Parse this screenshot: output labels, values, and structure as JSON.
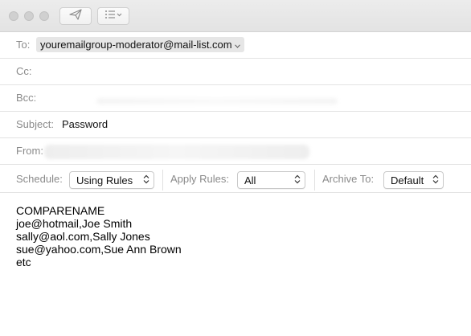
{
  "toolbar": {
    "send_icon": "paper-plane-icon",
    "format_icon": "list-format-icon"
  },
  "to": {
    "label": "To:",
    "recipient": "youremailgroup-moderator@mail-list.com"
  },
  "cc": {
    "label": "Cc:"
  },
  "bcc": {
    "label": "Bcc:"
  },
  "subject": {
    "label": "Subject:",
    "value": "Password"
  },
  "from": {
    "label": "From:"
  },
  "options": {
    "schedule_label": "Schedule:",
    "schedule_value": "Using Rules",
    "apply_rules_label": "Apply Rules:",
    "apply_rules_value": "All",
    "archive_label": "Archive To:",
    "archive_value": "Default"
  },
  "body": {
    "lines": [
      "COMPARENAME",
      "joe@hotmail,Joe Smith",
      "sally@aol.com,Sally Jones",
      "sue@yahoo.com,Sue Ann Brown",
      "etc"
    ]
  }
}
